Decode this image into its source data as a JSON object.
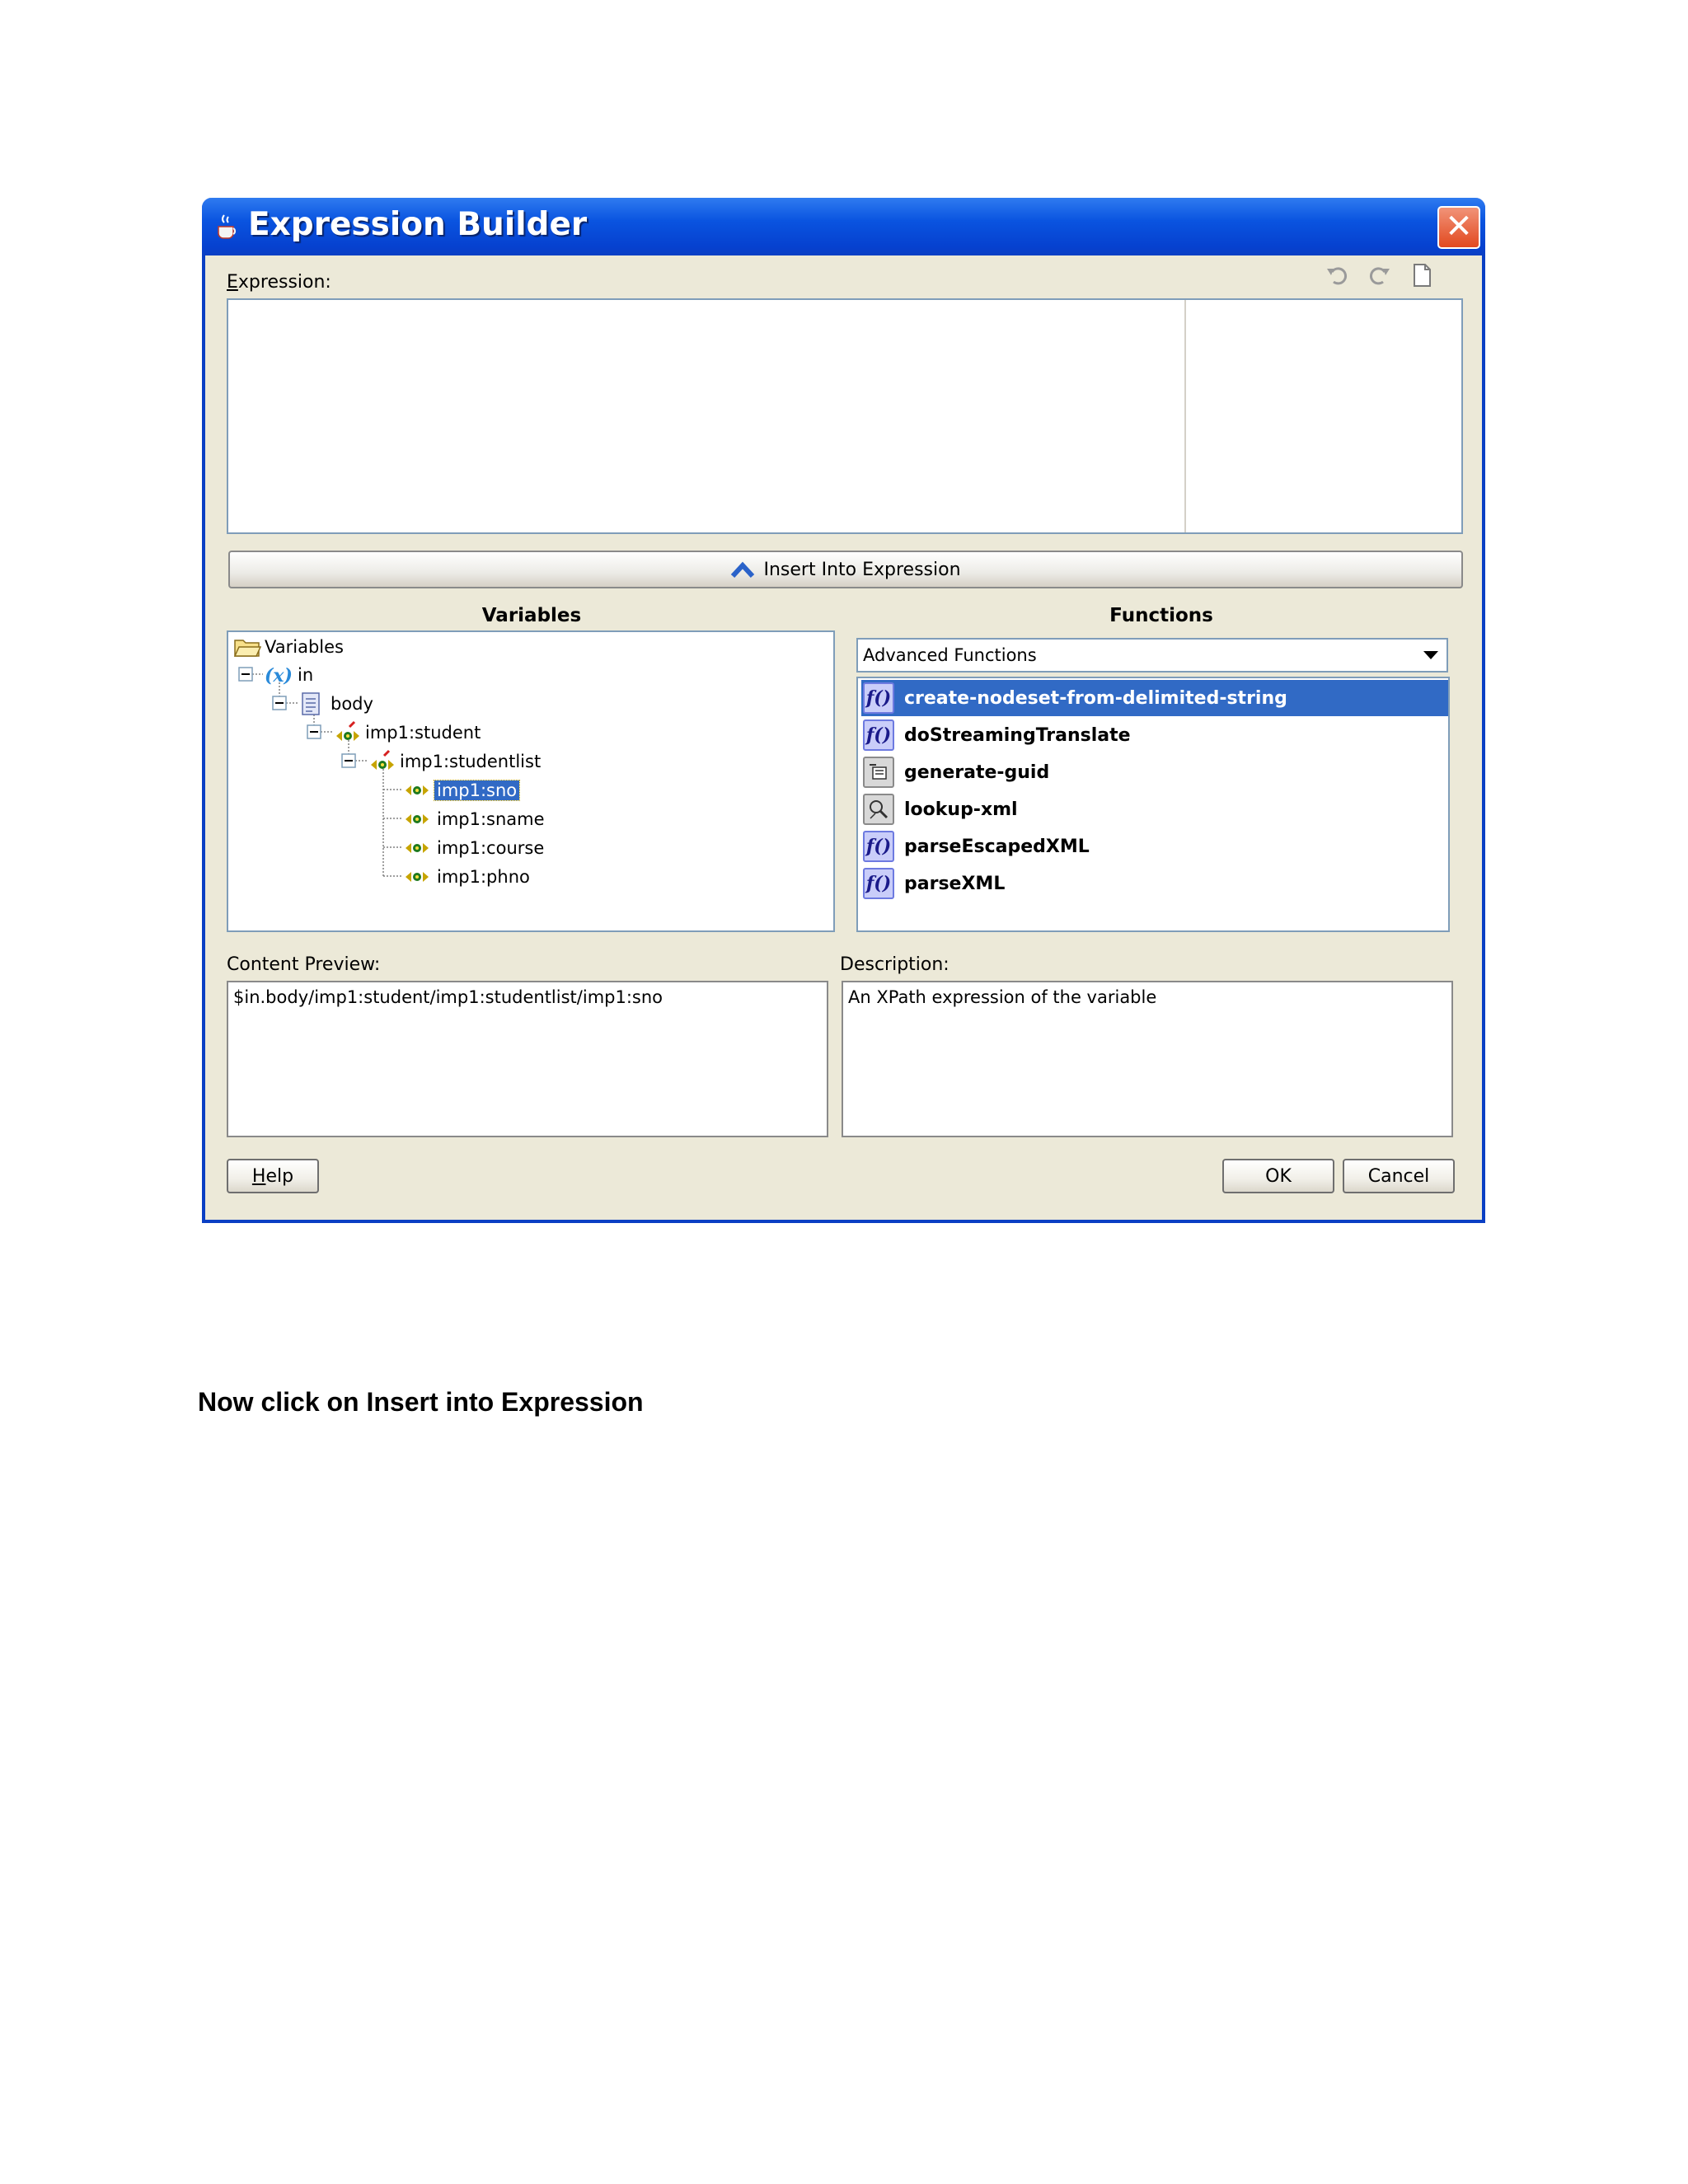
{
  "window": {
    "title": "Expression Builder",
    "close_symbol": "✕"
  },
  "expression": {
    "label_first": "E",
    "label_rest": "xpression:",
    "value": ""
  },
  "toolbar": {
    "icons": [
      "undo-icon",
      "redo-icon",
      "new-document-icon"
    ]
  },
  "insert_button": {
    "label": "Insert Into Expression"
  },
  "variables": {
    "title": "Variables",
    "tree": [
      {
        "label": "Variables",
        "icon": "folder-icon",
        "level": 0
      },
      {
        "label": "in",
        "icon": "variable-x-icon",
        "level": 0
      },
      {
        "label": "body",
        "icon": "document-icon",
        "level": 1
      },
      {
        "label": "imp1:student",
        "icon": "element-icon",
        "level": 2
      },
      {
        "label": "imp1:studentlist",
        "icon": "element-icon",
        "level": 3
      },
      {
        "label": "imp1:sno",
        "icon": "element-icon",
        "level": 4,
        "selected": true
      },
      {
        "label": "imp1:sname",
        "icon": "element-icon",
        "level": 4
      },
      {
        "label": "imp1:course",
        "icon": "element-icon",
        "level": 4
      },
      {
        "label": "imp1:phno",
        "icon": "element-icon",
        "level": 4
      }
    ]
  },
  "functions": {
    "title": "Functions",
    "category": "Advanced Functions",
    "items": [
      {
        "label": "create-nodeset-from-delimited-string",
        "icon": "function-icon",
        "selected": true
      },
      {
        "label": "doStreamingTranslate",
        "icon": "function-icon"
      },
      {
        "label": "generate-guid",
        "icon": "guid-icon"
      },
      {
        "label": "lookup-xml",
        "icon": "lookup-icon"
      },
      {
        "label": "parseEscapedXML",
        "icon": "function-icon"
      },
      {
        "label": "parseXML",
        "icon": "function-icon"
      }
    ]
  },
  "content_preview": {
    "label": "Content Preview:",
    "value": "$in.body/imp1:student/imp1:studentlist/imp1:sno"
  },
  "description": {
    "label": "Description:",
    "value": "An XPath expression of the variable"
  },
  "buttons": {
    "help_first": "H",
    "help_rest": "elp",
    "ok": "OK",
    "cancel": "Cancel"
  },
  "caption": "Now click on Insert into Expression"
}
